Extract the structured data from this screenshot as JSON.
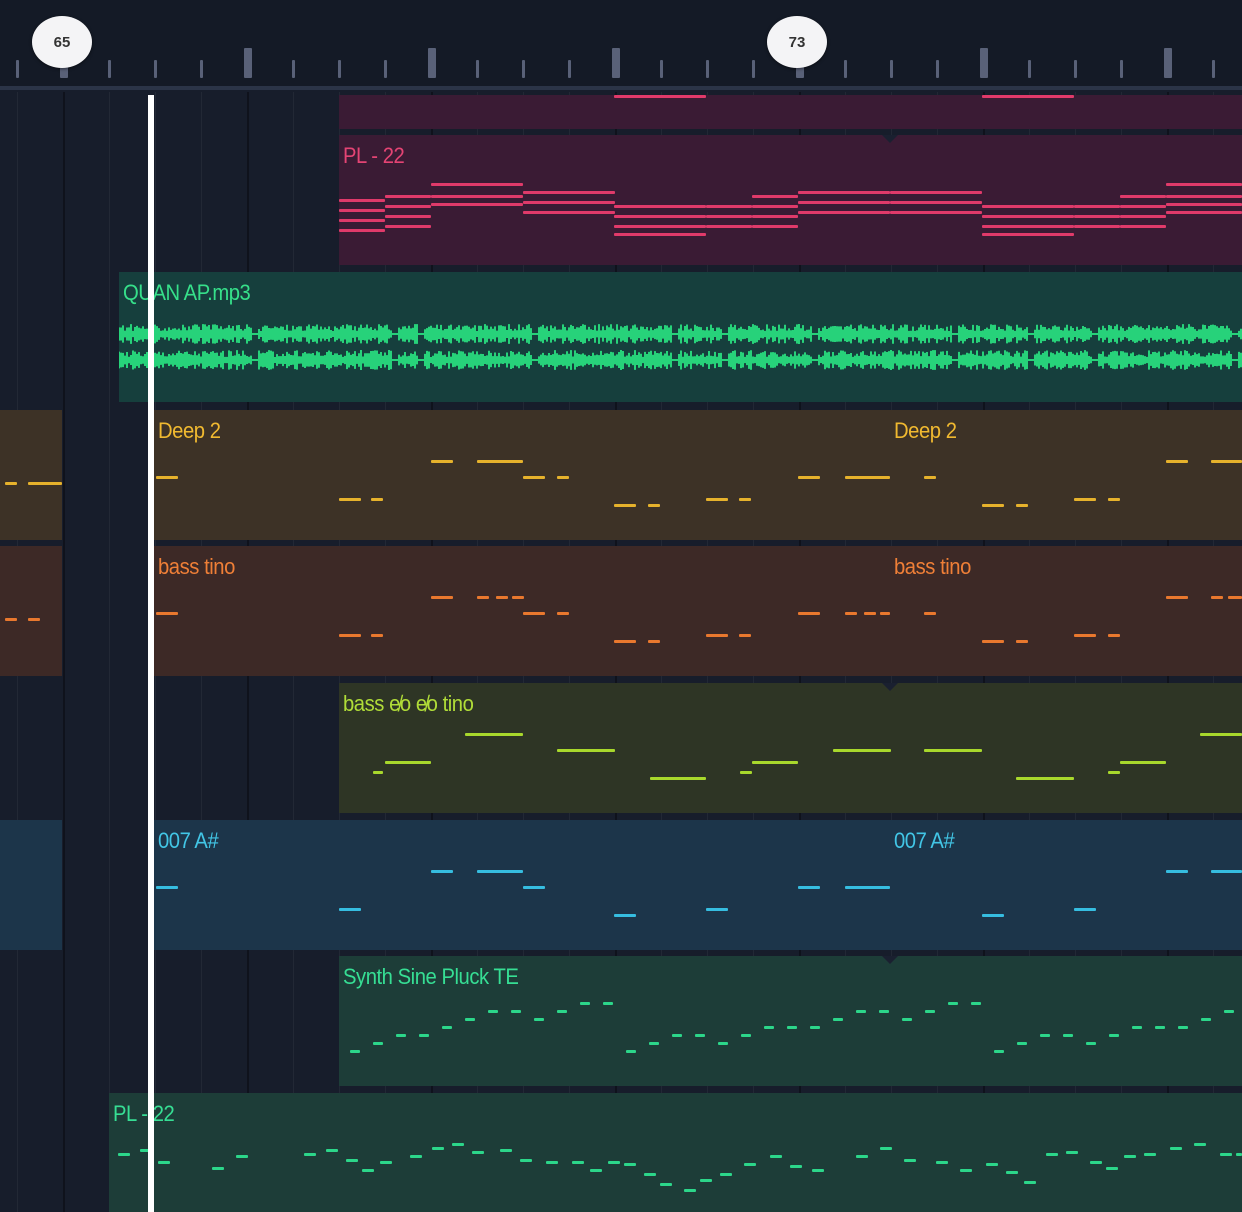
{
  "timeline": {
    "markers": [
      {
        "label": "65",
        "name": "bar-marker-65"
      },
      {
        "label": "73",
        "name": "bar-marker-73"
      }
    ]
  },
  "tracks": [
    {
      "name": "track-pl-22",
      "clips": [
        {
          "label": "",
          "color": "#3a1b34",
          "note_color": "#e03a6a"
        },
        {
          "label": "PL - 22",
          "color": "#3a1b34",
          "note_color": "#e03a6a",
          "label_color": "#e44474"
        }
      ]
    },
    {
      "name": "track-audio",
      "clips": [
        {
          "label": "QUAN AP.mp3",
          "color": "#163f3d",
          "wave_color": "#27d27a",
          "label_color": "#36e08a"
        }
      ]
    },
    {
      "name": "track-deep-2",
      "clips": [
        {
          "label": "",
          "color": "#3d3226",
          "note_color": "#e6b22c"
        },
        {
          "label": "Deep 2",
          "color": "#3d3226",
          "note_color": "#e6b22c",
          "label_color": "#f0b930"
        },
        {
          "label": "Deep 2",
          "color": "#3d3226",
          "note_color": "#e6b22c",
          "label_color": "#f0b930"
        }
      ]
    },
    {
      "name": "track-bass-tino",
      "clips": [
        {
          "label": "",
          "color": "#3d2926",
          "note_color": "#e9782e"
        },
        {
          "label": "bass tino",
          "color": "#3d2926",
          "note_color": "#e9782e",
          "label_color": "#ef7f37"
        },
        {
          "label": "bass tino",
          "color": "#3d2926",
          "note_color": "#e9782e",
          "label_color": "#ef7f37"
        }
      ]
    },
    {
      "name": "track-bass-echo",
      "clips": [
        {
          "label": "bass e̸o e̸o tino",
          "color": "#2e3525",
          "note_color": "#a8d82c",
          "label_color": "#b0dc38"
        }
      ]
    },
    {
      "name": "track-007",
      "clips": [
        {
          "label": "",
          "color": "#1c354a",
          "note_color": "#36bde0"
        },
        {
          "label": "007 A#",
          "color": "#1c354a",
          "note_color": "#36bde0",
          "label_color": "#42c6e6"
        },
        {
          "label": "007 A#",
          "color": "#1c354a",
          "note_color": "#36bde0",
          "label_color": "#42c6e6"
        }
      ]
    },
    {
      "name": "track-synth-sine-pluck",
      "clips": [
        {
          "label": "Synth Sine Pluck TE",
          "color": "#1d3d38",
          "note_color": "#2cd68a",
          "label_color": "#36de94"
        }
      ]
    },
    {
      "name": "track-pl-2",
      "clips": [
        {
          "label": "PL - 22",
          "color": "#1d3d38",
          "note_color": "#2cd68a",
          "label_color": "#36de94"
        }
      ]
    }
  ]
}
